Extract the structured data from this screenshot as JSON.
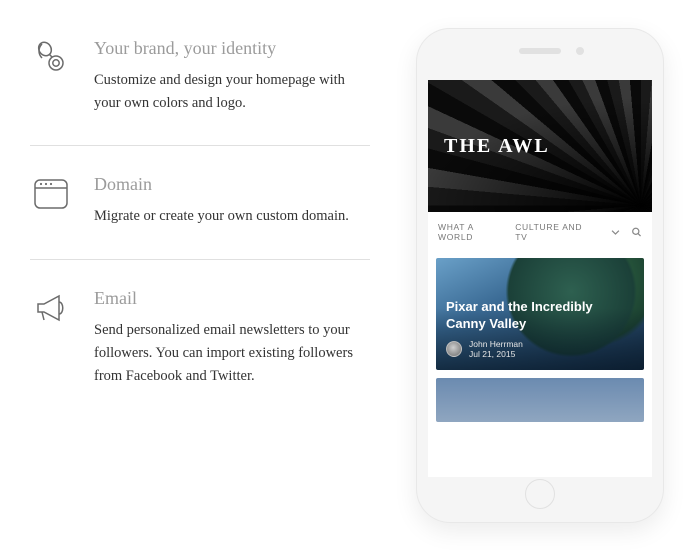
{
  "features": [
    {
      "title": "Your brand, your identity",
      "desc": "Customize and design your homepage with your own colors and logo."
    },
    {
      "title": "Domain",
      "desc": "Migrate or create your own custom domain."
    },
    {
      "title": "Email",
      "desc": "Send personalized email newsletters to your followers. You can import existing followers from Facebook and Twitter."
    }
  ],
  "phone": {
    "hero_title": "THE AWL",
    "nav": {
      "item1": "WHAT A WORLD",
      "item2": "CULTURE AND TV"
    },
    "card": {
      "title": "Pixar and the Incredibly Canny Valley",
      "author": "John Herrman",
      "date": "Jul 21, 2015"
    }
  }
}
